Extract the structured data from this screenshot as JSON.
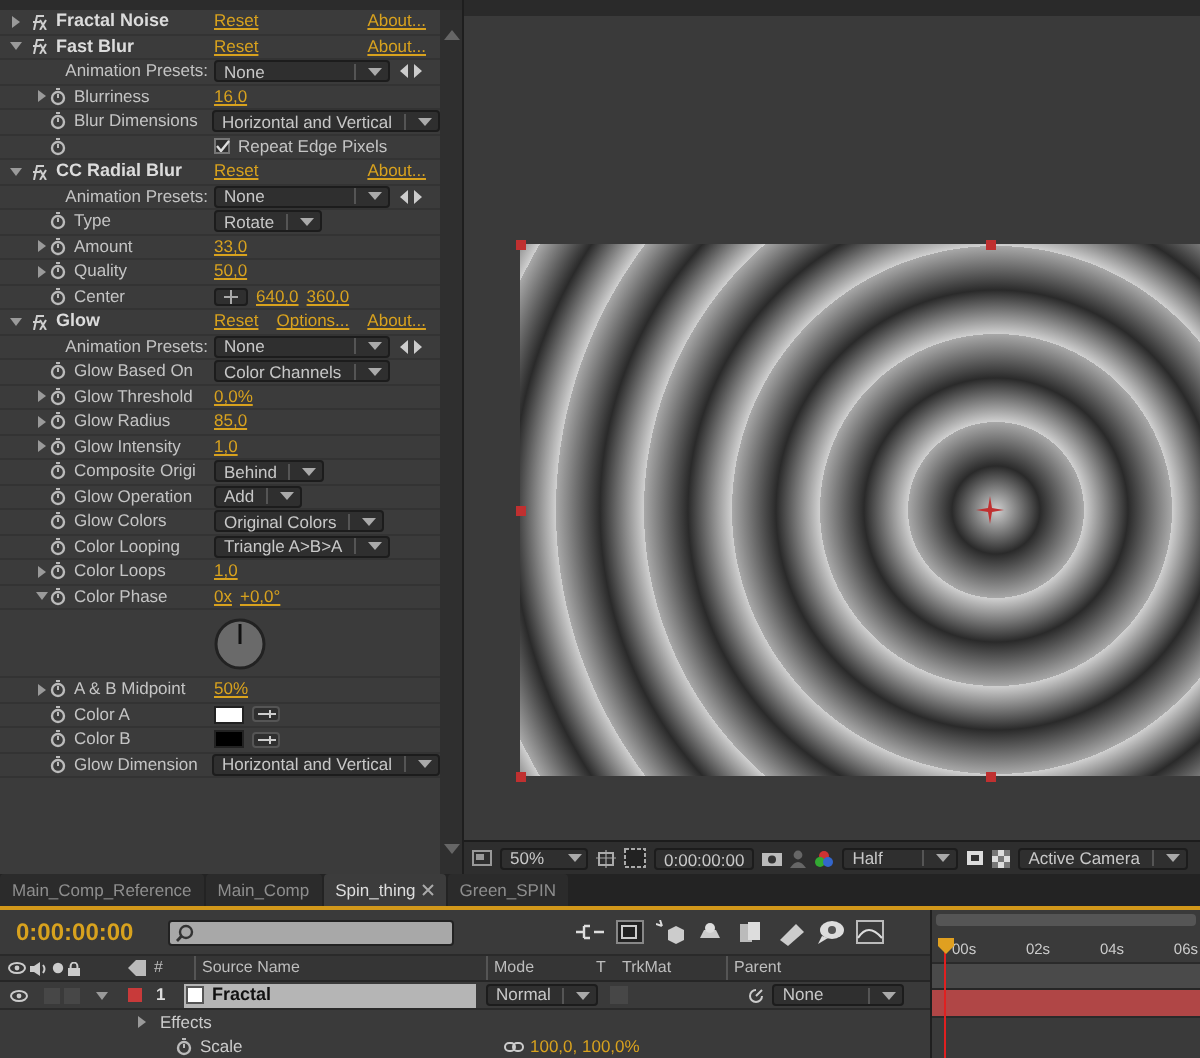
{
  "effects": [
    {
      "name": "Fractal Noise",
      "expanded": false,
      "links": [
        "Reset",
        "About..."
      ]
    },
    {
      "name": "Fast Blur",
      "expanded": true,
      "links": [
        "Reset",
        "About..."
      ],
      "properties": [
        {
          "kind": "presets",
          "label": "Animation Presets:",
          "value": "None"
        },
        {
          "kind": "number",
          "label": "Blurriness",
          "expanded": false,
          "value": "16,0"
        },
        {
          "kind": "dropdown",
          "label": "Blur Dimensions",
          "value": "Horizontal and Vertical"
        },
        {
          "kind": "checkbox",
          "label": "Repeat Edge Pixels",
          "checked": true
        }
      ]
    },
    {
      "name": "CC Radial Blur",
      "expanded": true,
      "links": [
        "Reset",
        "About..."
      ],
      "properties": [
        {
          "kind": "presets",
          "label": "Animation Presets:",
          "value": "None"
        },
        {
          "kind": "dropdown",
          "label": "Type",
          "value": "Rotate"
        },
        {
          "kind": "number",
          "label": "Amount",
          "expanded": false,
          "value": "33,0"
        },
        {
          "kind": "number",
          "label": "Quality",
          "expanded": false,
          "value": "50,0"
        },
        {
          "kind": "point",
          "label": "Center",
          "values": [
            "640,0",
            "360,0"
          ]
        }
      ]
    },
    {
      "name": "Glow",
      "expanded": true,
      "links": [
        "Reset",
        "Options...",
        "About..."
      ],
      "properties": [
        {
          "kind": "presets",
          "label": "Animation Presets:",
          "value": "None"
        },
        {
          "kind": "dropdown",
          "label": "Glow Based On",
          "value": "Color Channels"
        },
        {
          "kind": "number",
          "label": "Glow Threshold",
          "expanded": false,
          "value": "0,0%"
        },
        {
          "kind": "number",
          "label": "Glow Radius",
          "expanded": false,
          "value": "85,0"
        },
        {
          "kind": "number",
          "label": "Glow Intensity",
          "expanded": false,
          "value": "1,0"
        },
        {
          "kind": "dropdown",
          "label": "Composite Origi",
          "value": "Behind"
        },
        {
          "kind": "dropdown",
          "label": "Glow Operation",
          "value": "Add"
        },
        {
          "kind": "dropdown",
          "label": "Glow Colors",
          "value": "Original Colors"
        },
        {
          "kind": "dropdown",
          "label": "Color Looping",
          "value": "Triangle A>B>A"
        },
        {
          "kind": "number",
          "label": "Color Loops",
          "expanded": false,
          "value": "1,0"
        },
        {
          "kind": "angle",
          "label": "Color Phase",
          "expanded": true,
          "values": [
            "0x",
            "+0,0°"
          ]
        },
        {
          "kind": "number",
          "label": "A & B Midpoint",
          "expanded": false,
          "value": "50%"
        },
        {
          "kind": "color",
          "label": "Color A",
          "color": "#ffffff"
        },
        {
          "kind": "color",
          "label": "Color B",
          "color": "#000000"
        },
        {
          "kind": "dropdown",
          "label": "Glow Dimension",
          "value": "Horizontal and Vertical"
        }
      ]
    }
  ],
  "viewer": {
    "zoom": "50%",
    "timecode": "0:00:00:00",
    "resolution": "Half",
    "view": "Active Camera"
  },
  "tabs": [
    {
      "label": "Main_Comp_Reference",
      "selected": false
    },
    {
      "label": "Main_Comp",
      "selected": false
    },
    {
      "label": "Spin_thing",
      "selected": true
    },
    {
      "label": "Green_SPIN",
      "selected": false
    }
  ],
  "timeline": {
    "timecode": "0:00:00:00",
    "ruler": [
      "00s",
      "02s",
      "04s",
      "06s"
    ],
    "columns": [
      "#",
      "Source Name",
      "Mode",
      "T",
      "TrkMat",
      "Parent"
    ],
    "layers": [
      {
        "number": "1",
        "name": "Fractal",
        "color": "#c83a3a",
        "expanded": true,
        "mode": "Normal",
        "parent": "None",
        "rows": [
          {
            "kind": "group",
            "label": "Effects",
            "expanded": false
          },
          {
            "kind": "property",
            "label": "Scale",
            "value": "100,0, 100,0%"
          }
        ]
      }
    ]
  }
}
